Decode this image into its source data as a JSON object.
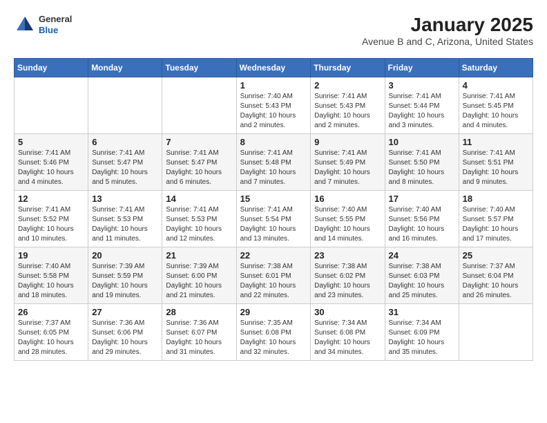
{
  "header": {
    "logo": {
      "general": "General",
      "blue": "Blue"
    },
    "title": "January 2025",
    "subtitle": "Avenue B and C, Arizona, United States"
  },
  "days_of_week": [
    "Sunday",
    "Monday",
    "Tuesday",
    "Wednesday",
    "Thursday",
    "Friday",
    "Saturday"
  ],
  "weeks": [
    [
      {
        "day": "",
        "info": ""
      },
      {
        "day": "",
        "info": ""
      },
      {
        "day": "",
        "info": ""
      },
      {
        "day": "1",
        "info": "Sunrise: 7:40 AM\nSunset: 5:43 PM\nDaylight: 10 hours\nand 2 minutes."
      },
      {
        "day": "2",
        "info": "Sunrise: 7:41 AM\nSunset: 5:43 PM\nDaylight: 10 hours\nand 2 minutes."
      },
      {
        "day": "3",
        "info": "Sunrise: 7:41 AM\nSunset: 5:44 PM\nDaylight: 10 hours\nand 3 minutes."
      },
      {
        "day": "4",
        "info": "Sunrise: 7:41 AM\nSunset: 5:45 PM\nDaylight: 10 hours\nand 4 minutes."
      }
    ],
    [
      {
        "day": "5",
        "info": "Sunrise: 7:41 AM\nSunset: 5:46 PM\nDaylight: 10 hours\nand 4 minutes."
      },
      {
        "day": "6",
        "info": "Sunrise: 7:41 AM\nSunset: 5:47 PM\nDaylight: 10 hours\nand 5 minutes."
      },
      {
        "day": "7",
        "info": "Sunrise: 7:41 AM\nSunset: 5:47 PM\nDaylight: 10 hours\nand 6 minutes."
      },
      {
        "day": "8",
        "info": "Sunrise: 7:41 AM\nSunset: 5:48 PM\nDaylight: 10 hours\nand 7 minutes."
      },
      {
        "day": "9",
        "info": "Sunrise: 7:41 AM\nSunset: 5:49 PM\nDaylight: 10 hours\nand 7 minutes."
      },
      {
        "day": "10",
        "info": "Sunrise: 7:41 AM\nSunset: 5:50 PM\nDaylight: 10 hours\nand 8 minutes."
      },
      {
        "day": "11",
        "info": "Sunrise: 7:41 AM\nSunset: 5:51 PM\nDaylight: 10 hours\nand 9 minutes."
      }
    ],
    [
      {
        "day": "12",
        "info": "Sunrise: 7:41 AM\nSunset: 5:52 PM\nDaylight: 10 hours\nand 10 minutes."
      },
      {
        "day": "13",
        "info": "Sunrise: 7:41 AM\nSunset: 5:53 PM\nDaylight: 10 hours\nand 11 minutes."
      },
      {
        "day": "14",
        "info": "Sunrise: 7:41 AM\nSunset: 5:53 PM\nDaylight: 10 hours\nand 12 minutes."
      },
      {
        "day": "15",
        "info": "Sunrise: 7:41 AM\nSunset: 5:54 PM\nDaylight: 10 hours\nand 13 minutes."
      },
      {
        "day": "16",
        "info": "Sunrise: 7:40 AM\nSunset: 5:55 PM\nDaylight: 10 hours\nand 14 minutes."
      },
      {
        "day": "17",
        "info": "Sunrise: 7:40 AM\nSunset: 5:56 PM\nDaylight: 10 hours\nand 16 minutes."
      },
      {
        "day": "18",
        "info": "Sunrise: 7:40 AM\nSunset: 5:57 PM\nDaylight: 10 hours\nand 17 minutes."
      }
    ],
    [
      {
        "day": "19",
        "info": "Sunrise: 7:40 AM\nSunset: 5:58 PM\nDaylight: 10 hours\nand 18 minutes."
      },
      {
        "day": "20",
        "info": "Sunrise: 7:39 AM\nSunset: 5:59 PM\nDaylight: 10 hours\nand 19 minutes."
      },
      {
        "day": "21",
        "info": "Sunrise: 7:39 AM\nSunset: 6:00 PM\nDaylight: 10 hours\nand 21 minutes."
      },
      {
        "day": "22",
        "info": "Sunrise: 7:38 AM\nSunset: 6:01 PM\nDaylight: 10 hours\nand 22 minutes."
      },
      {
        "day": "23",
        "info": "Sunrise: 7:38 AM\nSunset: 6:02 PM\nDaylight: 10 hours\nand 23 minutes."
      },
      {
        "day": "24",
        "info": "Sunrise: 7:38 AM\nSunset: 6:03 PM\nDaylight: 10 hours\nand 25 minutes."
      },
      {
        "day": "25",
        "info": "Sunrise: 7:37 AM\nSunset: 6:04 PM\nDaylight: 10 hours\nand 26 minutes."
      }
    ],
    [
      {
        "day": "26",
        "info": "Sunrise: 7:37 AM\nSunset: 6:05 PM\nDaylight: 10 hours\nand 28 minutes."
      },
      {
        "day": "27",
        "info": "Sunrise: 7:36 AM\nSunset: 6:06 PM\nDaylight: 10 hours\nand 29 minutes."
      },
      {
        "day": "28",
        "info": "Sunrise: 7:36 AM\nSunset: 6:07 PM\nDaylight: 10 hours\nand 31 minutes."
      },
      {
        "day": "29",
        "info": "Sunrise: 7:35 AM\nSunset: 6:08 PM\nDaylight: 10 hours\nand 32 minutes."
      },
      {
        "day": "30",
        "info": "Sunrise: 7:34 AM\nSunset: 6:08 PM\nDaylight: 10 hours\nand 34 minutes."
      },
      {
        "day": "31",
        "info": "Sunrise: 7:34 AM\nSunset: 6:09 PM\nDaylight: 10 hours\nand 35 minutes."
      },
      {
        "day": "",
        "info": ""
      }
    ]
  ]
}
